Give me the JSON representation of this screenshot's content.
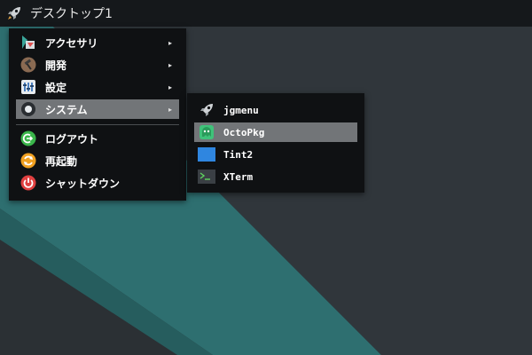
{
  "panel": {
    "title": "デスクトップ1",
    "launcher_icon": "rocket-icon"
  },
  "main_menu": {
    "items": [
      {
        "label": "アクセサリ",
        "icon": "accessories-icon",
        "has_submenu": true,
        "arrow": "▸"
      },
      {
        "label": "開発",
        "icon": "hammer-icon",
        "has_submenu": true,
        "arrow": "▸"
      },
      {
        "label": "設定",
        "icon": "settings-icon",
        "has_submenu": true,
        "arrow": "▸"
      },
      {
        "label": "システム",
        "icon": "system-icon",
        "has_submenu": true,
        "arrow": "▸",
        "active": true
      },
      {
        "label": "ログアウト",
        "icon": "logout-icon",
        "has_submenu": false
      },
      {
        "label": "再起動",
        "icon": "restart-icon",
        "has_submenu": false
      },
      {
        "label": "シャットダウン",
        "icon": "power-icon",
        "has_submenu": false
      }
    ]
  },
  "system_submenu": {
    "items": [
      {
        "label": "jgmenu",
        "icon": "rocket-icon"
      },
      {
        "label": "OctoPkg",
        "icon": "octopkg-icon",
        "active": true
      },
      {
        "label": "Tint2",
        "icon": "tint2-icon"
      },
      {
        "label": "XTerm",
        "icon": "terminal-icon"
      }
    ]
  },
  "colors": {
    "panel_bg": "#15181b",
    "menu_bg": "#0f1113",
    "highlight": "#727578",
    "wallpaper_teal": "#2e6f70",
    "wallpaper_dark": "#2b3034"
  }
}
